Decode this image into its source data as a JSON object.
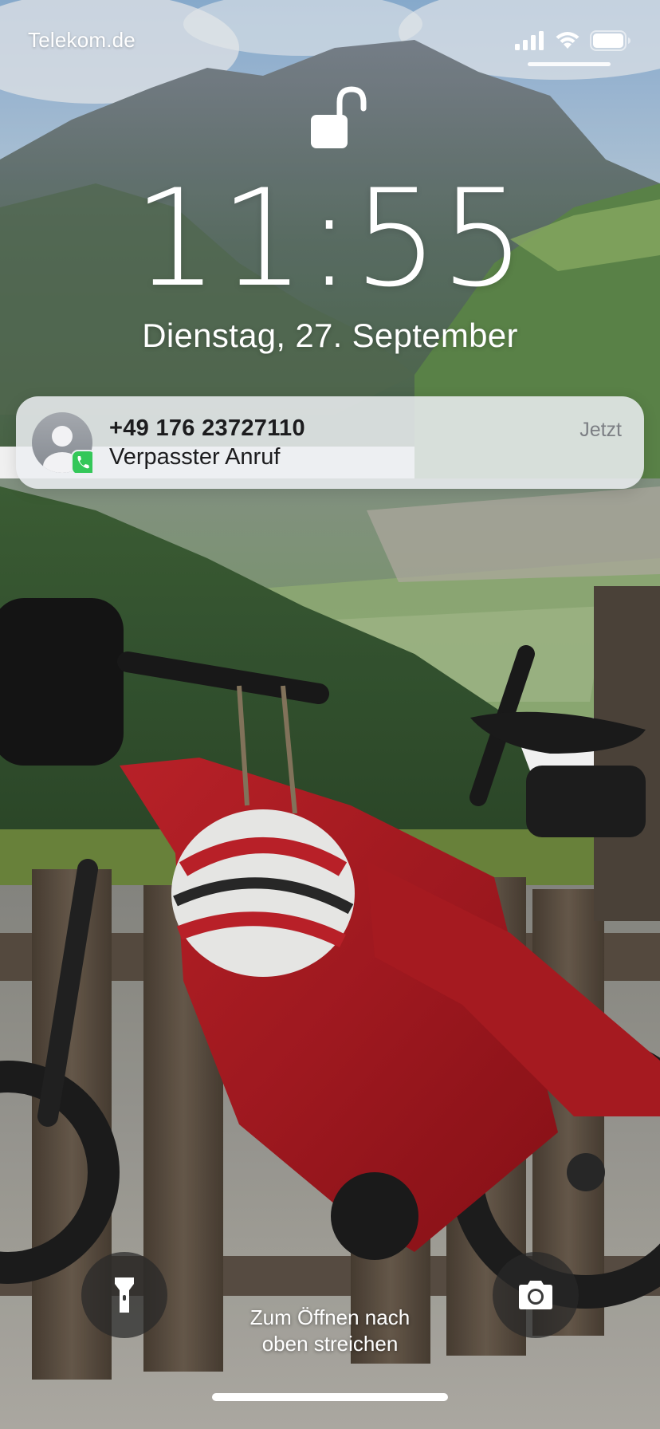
{
  "status_bar": {
    "carrier": "Telekom.de",
    "signal_icon": "cellular-signal-icon",
    "wifi_icon": "wifi-icon",
    "battery_icon": "battery-icon"
  },
  "lock": {
    "icon": "unlocked-padlock-icon"
  },
  "clock": {
    "time": "11:55",
    "date": "Dienstag, 27. September"
  },
  "notification": {
    "title": "+49 176 23727110",
    "body": "Verpasster Anruf",
    "time": "Jetzt",
    "app_icon": "phone-icon",
    "avatar_icon": "contact-avatar-icon"
  },
  "quick_actions": {
    "flashlight_icon": "flashlight-icon",
    "camera_icon": "camera-icon"
  },
  "swipe_hint": {
    "line1": "Zum Öffnen nach",
    "line2": "oben streichen"
  },
  "colors": {
    "notification_bg": "#eceff2",
    "text_primary": "#1c1c1e",
    "text_secondary": "#7c7f84",
    "phone_green": "#34c759"
  }
}
